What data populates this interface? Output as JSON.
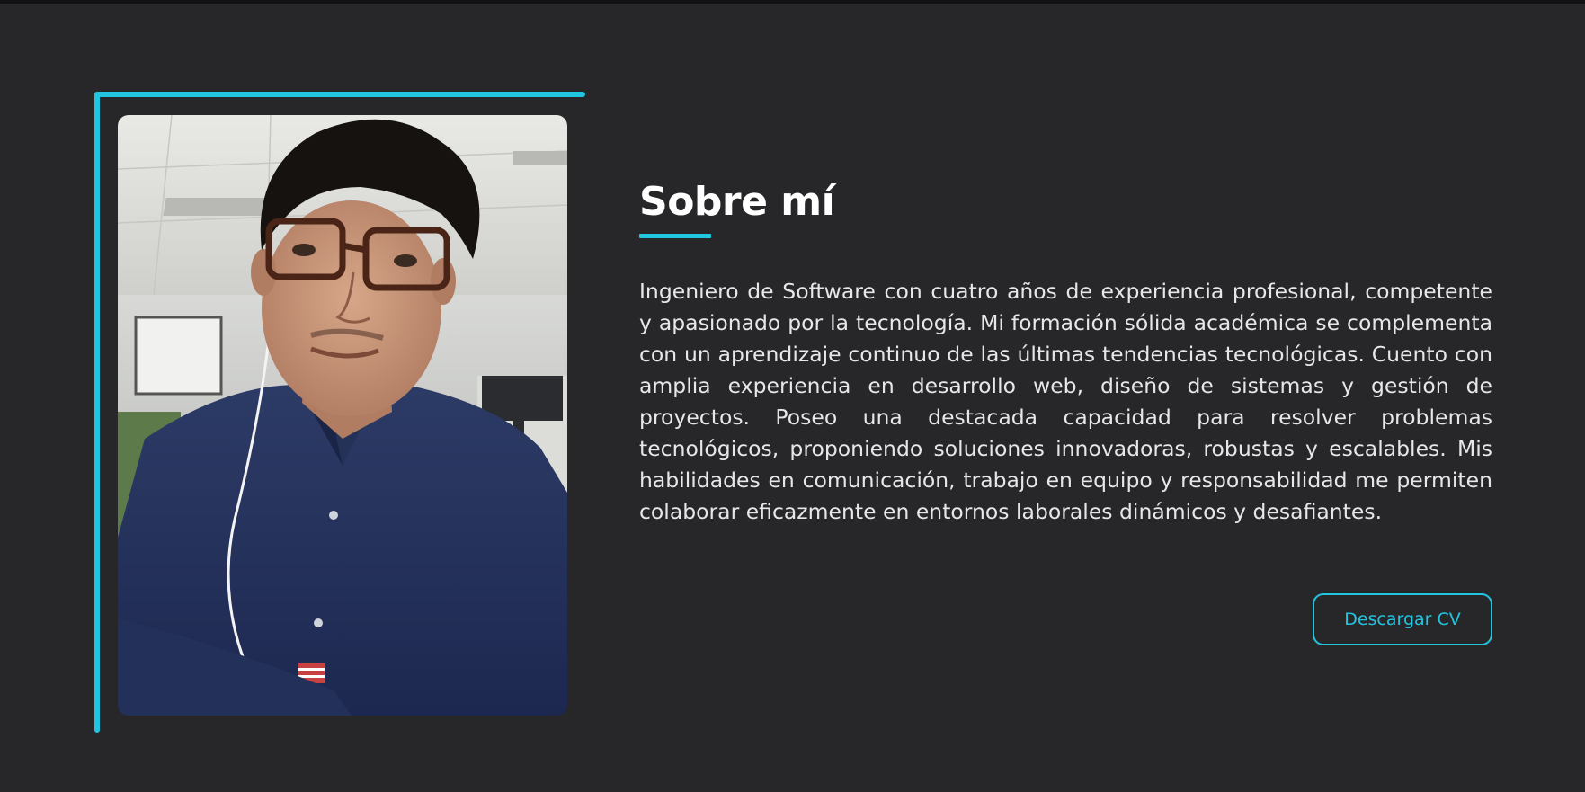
{
  "about": {
    "title": "Sobre mí",
    "bio": "Ingeniero de Software con cuatro años de experiencia profesional, competente y apasionado por la tecnología. Mi formación sólida académica se complementa con un aprendizaje continuo de las últimas tendencias tecnológicas. Cuento con amplia experiencia en desarrollo web, diseño de sistemas y gestión de proyectos. Poseo una destacada capacidad para resolver problemas tecnológicos, proponiendo soluciones innovadoras, robustas y escalables. Mis habilidades en comunicación, trabajo en equipo y responsabilidad me permiten colaborar eficazmente en entornos laborales dinámicos y desafiantes.",
    "cv_button_label": "Descargar CV"
  },
  "colors": {
    "background": "#27272a",
    "accent": "#22c5e0",
    "text": "#e7e7ea",
    "title": "#ffffff"
  }
}
